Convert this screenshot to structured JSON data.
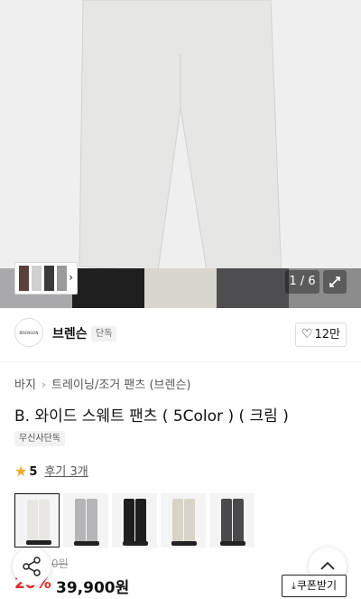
{
  "gallery": {
    "counter": "1 / 6",
    "product_color": "#e6e6e4",
    "bottom_colors": [
      "#a9a9ab",
      "#1f1f1f",
      "#d9d6cc",
      "#4e4e50",
      "#8c8c8c"
    ],
    "strip_colors": [
      "#5a3f3a",
      "#cfcfcf",
      "#3a3a3a",
      "#9a9a9a"
    ]
  },
  "brand": {
    "logo_text": "BRENSON",
    "name": "브렌슨",
    "badge": "단독",
    "like_count": "12만"
  },
  "breadcrumb": {
    "category": "바지",
    "subcategory": "트레이닝/조거 팬츠 (브렌슨)"
  },
  "product": {
    "title": "B. 와이드 스웨트 팬츠 ( 5Color ) ( 크림 )",
    "exclusive_tag": "무신사단독",
    "rating": "5",
    "review_link": "후기 3개"
  },
  "color_options": [
    {
      "name": "cream",
      "color": "#e7e6e3",
      "selected": true
    },
    {
      "name": "melange-grey",
      "color": "#b5b5b7",
      "selected": false
    },
    {
      "name": "black",
      "color": "#1e1e1e",
      "selected": false
    },
    {
      "name": "oatmeal",
      "color": "#d8d4ca",
      "selected": false
    },
    {
      "name": "charcoal",
      "color": "#4a4a4c",
      "selected": false
    }
  ],
  "price": {
    "original_partial": "0원",
    "discount": "20%",
    "sale_price": "39,900원"
  },
  "actions": {
    "coupon_label": "쿠폰받기",
    "accent_red": "#e0292b"
  }
}
